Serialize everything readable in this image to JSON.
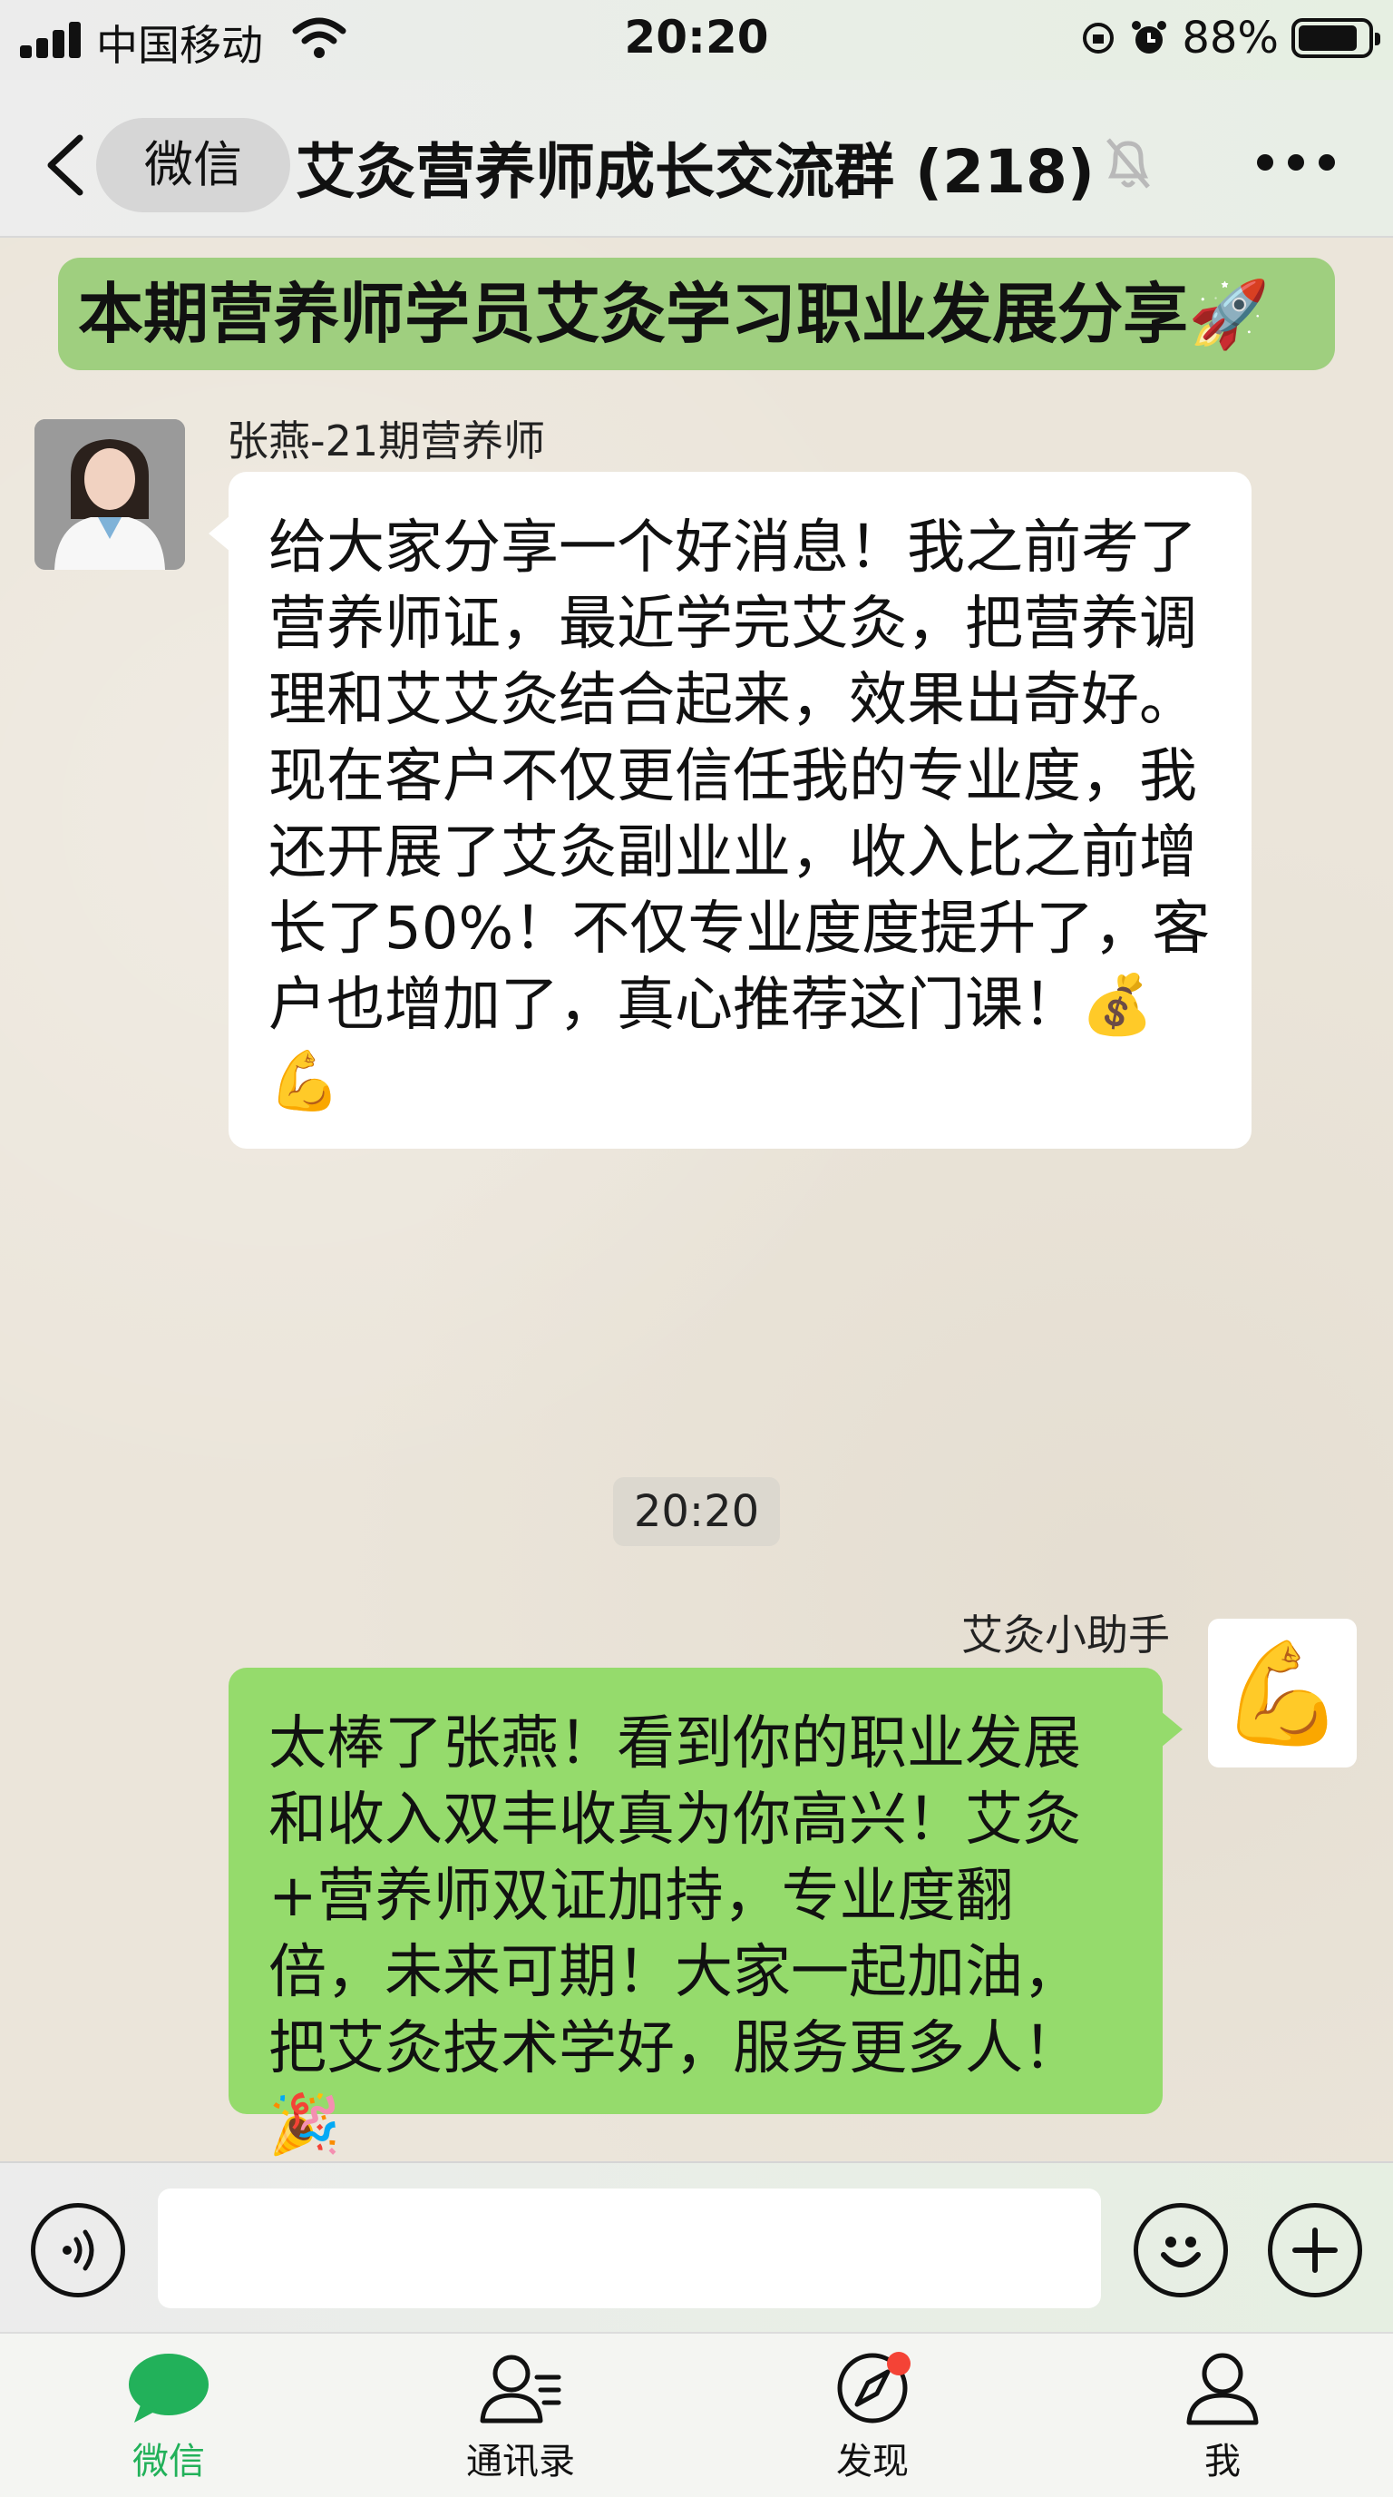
{
  "status_bar": {
    "carrier": "中国移动",
    "time": "20:20",
    "battery": "88%",
    "battery_level": 0.88
  },
  "nav": {
    "back_label": "微信",
    "title": "艾灸营养师成长交流群 (218)"
  },
  "pinned_banner": "本期营养师学员艾灸学习职业发展分享🚀",
  "messages": [
    {
      "sender": "张燕-21期营养师",
      "text": "给大家分享一个好消息！我之前考了营养师证，最近学完艾灸，把营养调理和艾艾灸结合起来，效果出奇好。现在客户不仅更信任我的专业度，我还开展了艾灸副业业，收入比之前增长了50%！不仅专业度度提升了，客户也增加了，真心推荐这门课！💰💪"
    },
    {
      "time": "20:20"
    },
    {
      "sender": "艾灸小助手",
      "avatar_emoji": "💪",
      "text": "太棒了张燕！看到你的职业发展和收入双丰收真为你高兴！艾灸+营养师双证加持，专业度翻倍，未来可期！大家一起加油，把艾灸技术学好，服务更多人！🎉"
    }
  ],
  "input": {
    "value": ""
  },
  "tabs": [
    {
      "label": "微信",
      "icon": "chat-bubble-icon",
      "active": true
    },
    {
      "label": "通讯录",
      "icon": "contacts-icon",
      "active": false
    },
    {
      "label": "发现",
      "icon": "compass-icon",
      "active": false,
      "badge": "dot"
    },
    {
      "label": "我",
      "icon": "person-icon",
      "active": false
    }
  ],
  "colors": {
    "accent_green": "#22b15a",
    "bubble_green": "#95db6c",
    "banner_green": "#9fcf7f",
    "badge_red": "#f44336"
  }
}
